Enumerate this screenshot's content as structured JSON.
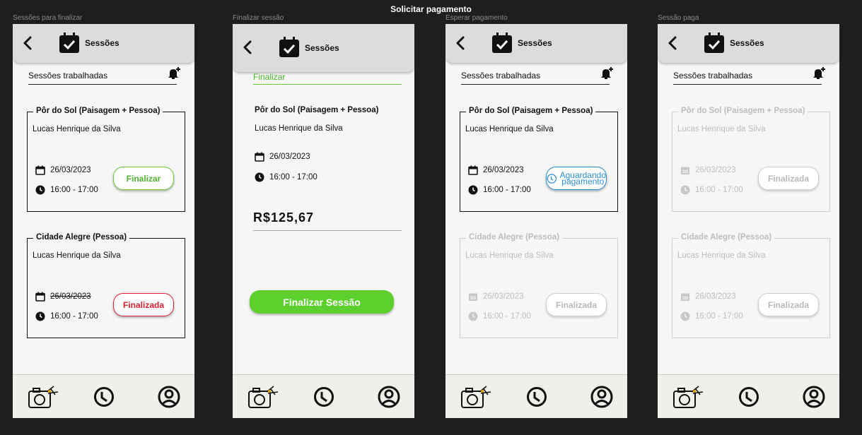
{
  "page_title": "Solicitar pagamento",
  "screens": [
    {
      "label": "Sessões para finalizar",
      "header_title": "Sessões",
      "tab_label": "Sessões trabalhadas",
      "cards": [
        {
          "title": "Pôr do Sol (Paisagem + Pessoa)",
          "client": "Lucas Henrique da Silva",
          "date": "26/03/2023",
          "time": "16:00 - 17:00",
          "button": "Finalizar"
        },
        {
          "title": "Cidade Alegre (Pessoa)",
          "client": "Lucas Henrique da Silva",
          "date": "26/03/2023",
          "time": "16:00 - 17:00",
          "button": "Finalizada"
        }
      ]
    },
    {
      "label": "Finalizar sessão",
      "header_title": "Sessões",
      "tab_label": "Finalizar",
      "title": "Pôr do Sol (Paisagem + Pessoa)",
      "client": "Lucas Henrique da Silva",
      "date": "26/03/2023",
      "time": "16:00 - 17:00",
      "price": "R$125,67",
      "button": "Finalizar Sessão"
    },
    {
      "label": "Esperar pagamento",
      "header_title": "Sessões",
      "tab_label": "Sessões trabalhadas",
      "cards": [
        {
          "title": "Pôr do Sol (Paisagem + Pessoa)",
          "client": "Lucas Henrique da Silva",
          "date": "26/03/2023",
          "time": "16:00 - 17:00",
          "button_line1": "Aguardando",
          "button_line2": "pagamento"
        },
        {
          "title": "Cidade Alegre (Pessoa)",
          "client": "Lucas Henrique da Silva",
          "date": "26/03/2023",
          "time": "16:00 - 17:00",
          "button": "Finalizada"
        }
      ]
    },
    {
      "label": "Sessão paga",
      "header_title": "Sessões",
      "tab_label": "Sessões trabalhadas",
      "cards": [
        {
          "title": "Pôr do Sol (Paisagem + Pessoa)",
          "client": "Lucas Henrique da Silva",
          "date": "26/03/2023",
          "time": "16:00 - 17:00",
          "button": "Finalizada"
        },
        {
          "title": "Cidade Alegre (Pessoa)",
          "client": "Lucas Henrique da Silva",
          "date": "26/03/2023",
          "time": "16:00 - 17:00",
          "button": "Finalizada"
        }
      ]
    }
  ],
  "icons": [
    "back-icon",
    "calendar-check-icon",
    "bell-plus-icon",
    "calendar-icon",
    "clock-icon",
    "camera-icon",
    "history-icon",
    "profile-icon"
  ],
  "colors": {
    "green": "#4fb32e",
    "red": "#e02030",
    "blue": "#2b8fd6",
    "header": "#dcdcdc"
  }
}
